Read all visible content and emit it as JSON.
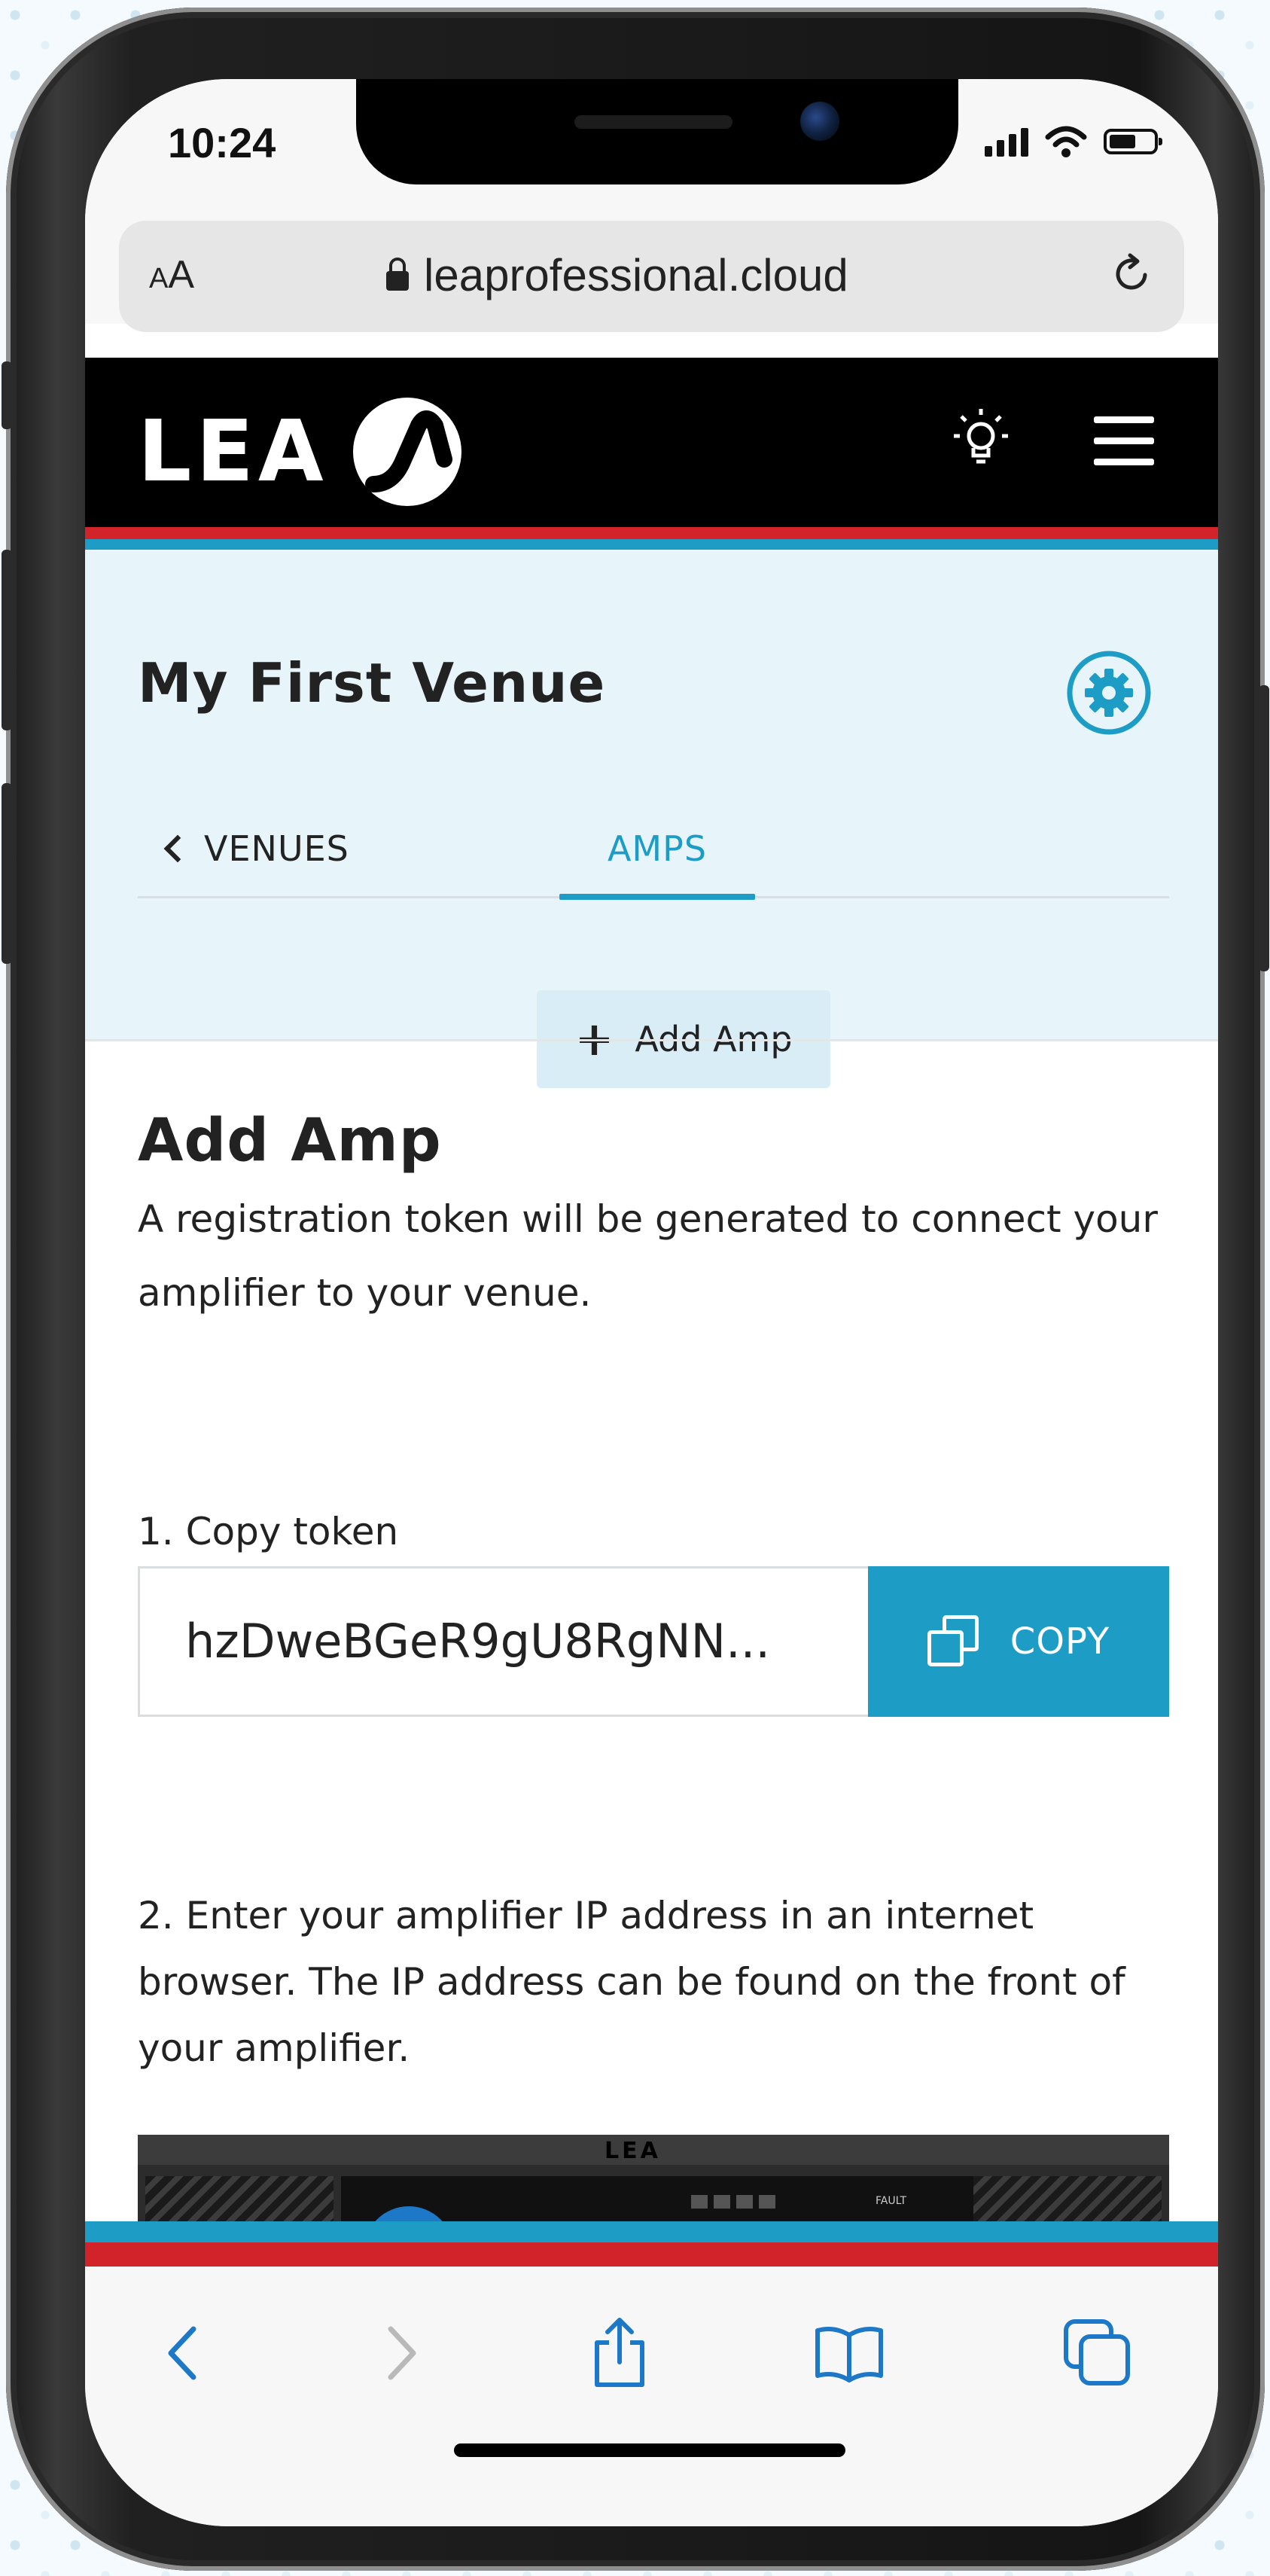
{
  "status_bar": {
    "time": "10:24"
  },
  "browser": {
    "text_size_label_big": "A",
    "text_size_label_small": "A",
    "url": "leaprofessional.cloud"
  },
  "header": {
    "logo_text": "LEA"
  },
  "venue": {
    "title": "My First Venue",
    "tabs": [
      {
        "label": "VENUES"
      },
      {
        "label": "AMPS"
      }
    ],
    "add_amp_button": "Add Amp"
  },
  "add_amp_form": {
    "title": "Add Amp",
    "description": "A registration token will be generated to connect your amplifier to your venue.",
    "step1_label": "1. Copy token",
    "token_value": "hzDweBGeR9gU8RgNN...",
    "copy_button": "COPY",
    "step2_text": "2. Enter your amplifier IP address in an internet browser. The IP address can be found on the front of your amplifier."
  },
  "amp_device": {
    "brand": "LEA",
    "status_label": "FAULT"
  },
  "colors": {
    "accent": "#1d9cc5",
    "brand_red": "#d2232a",
    "header_bg": "#000000",
    "venue_bg": "#e7f4fa"
  },
  "icons": {
    "lock": "lock-icon",
    "reload": "reload-icon",
    "bulb": "lightbulb-icon",
    "menu": "hamburger-menu-icon",
    "settings": "gear-icon",
    "back": "chevron-left-icon",
    "copy": "copy-icon",
    "share": "share-icon",
    "bookmarks": "book-icon",
    "tabs": "tabs-icon"
  }
}
